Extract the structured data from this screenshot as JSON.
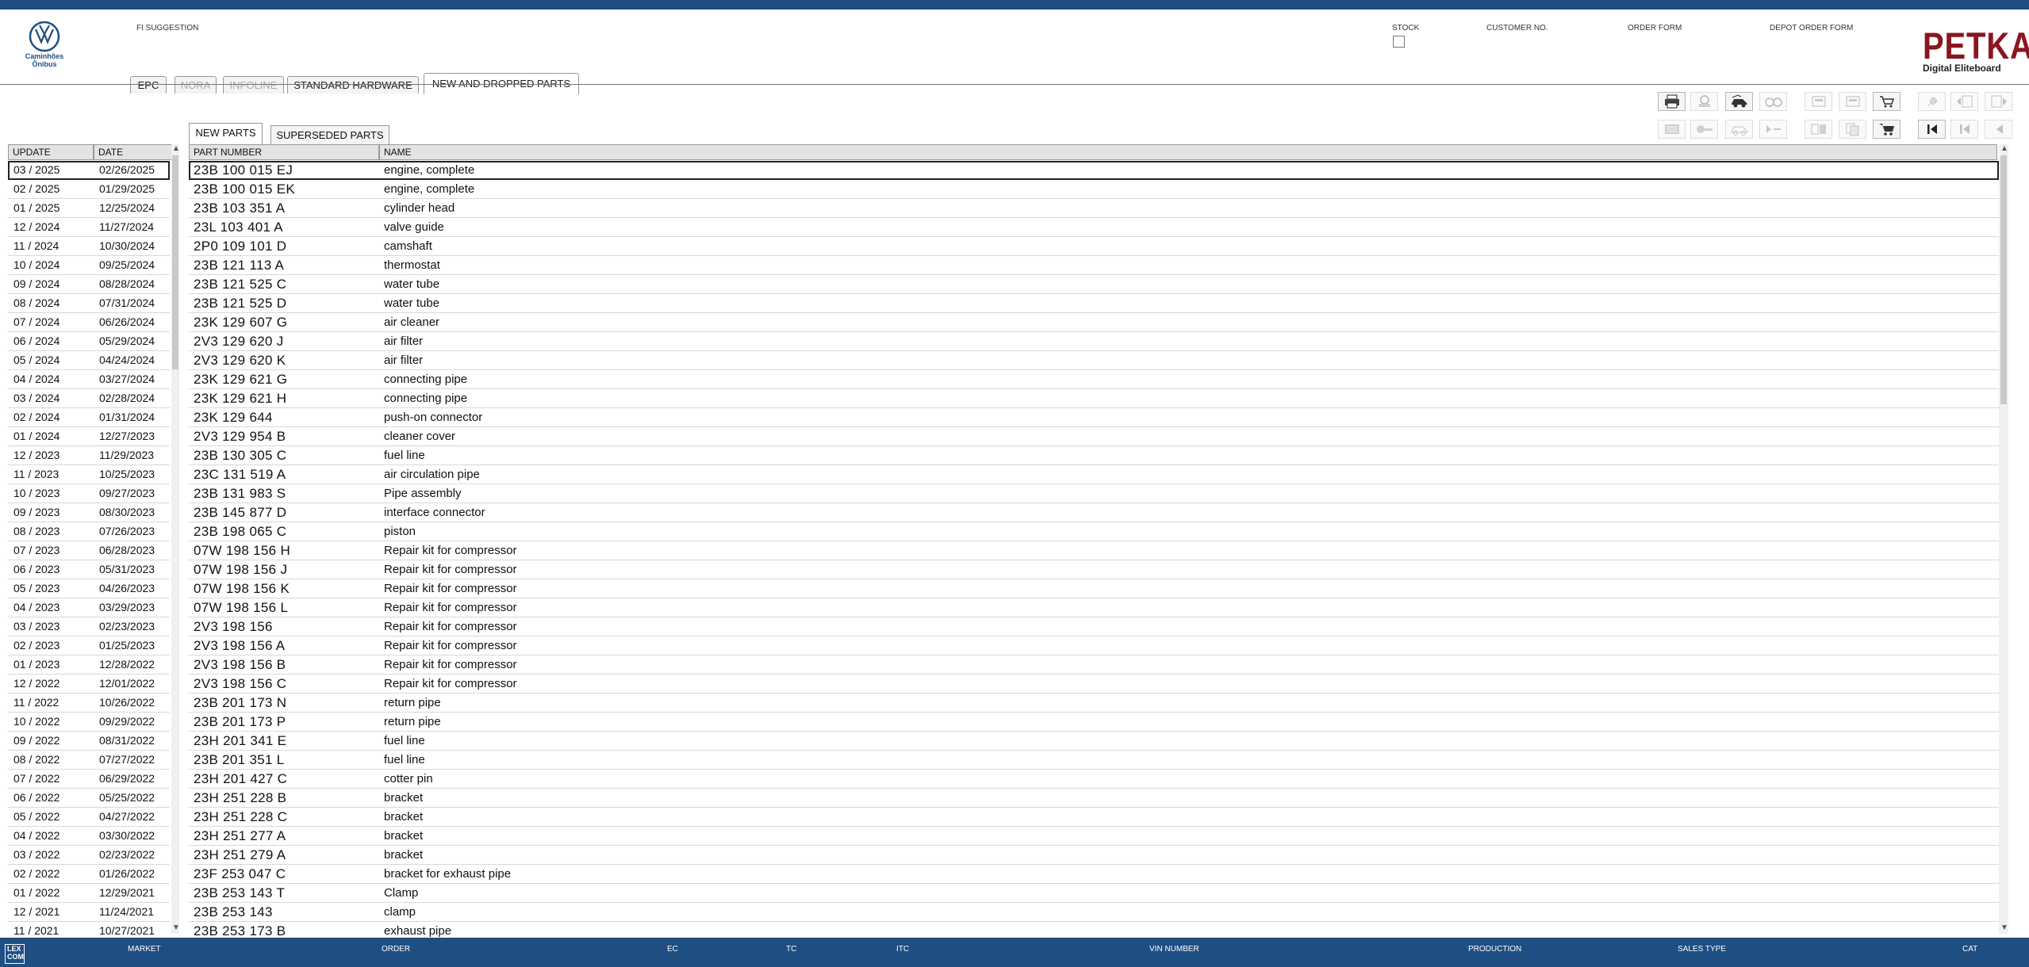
{
  "header": {
    "logo_text_line1": "Caminhões",
    "logo_text_line2": "Ônibus",
    "fi_suggestion": "FI SUGGESTION",
    "stock": "STOCK",
    "customer_no": "CUSTOMER NO.",
    "order_form": "ORDER FORM",
    "depot_order_form": "DEPOT ORDER FORM",
    "brand_big": "PETKA",
    "brand_small": "Digital Eliteboard"
  },
  "main_tabs": [
    {
      "label": "EPC",
      "state": "normal"
    },
    {
      "label": "NORA",
      "state": "disabled"
    },
    {
      "label": "INFOLINE",
      "state": "disabled"
    },
    {
      "label": "STANDARD HARDWARE",
      "state": "normal"
    },
    {
      "label": "NEW AND DROPPED PARTS",
      "state": "active"
    }
  ],
  "sub_tabs": [
    {
      "label": "NEW PARTS",
      "state": "active"
    },
    {
      "label": "SUPERSEDED PARTS",
      "state": "normal"
    }
  ],
  "toolbar": {
    "row1": [
      "print-icon",
      "user-icon",
      "car-icon",
      "glasses-icon",
      "device-icon",
      "device-icon-2",
      "cart-select-icon",
      "pin-icon",
      "page-back-icon",
      "page-forward-icon"
    ],
    "row2": [
      "list-icon",
      "key-icon",
      "car-outline-icon",
      "arrow-dash-icon",
      "layout-icon",
      "copy-icon",
      "cart-icon",
      "first-page-icon",
      "prev-page-icon",
      "prev-icon"
    ]
  },
  "left_table": {
    "headers": [
      "UPDATE",
      "DATE"
    ],
    "selected_index": 0,
    "rows": [
      [
        "03 / 2025",
        "02/26/2025"
      ],
      [
        "02 / 2025",
        "01/29/2025"
      ],
      [
        "01 / 2025",
        "12/25/2024"
      ],
      [
        "12 / 2024",
        "11/27/2024"
      ],
      [
        "11 / 2024",
        "10/30/2024"
      ],
      [
        "10 / 2024",
        "09/25/2024"
      ],
      [
        "09 / 2024",
        "08/28/2024"
      ],
      [
        "08 / 2024",
        "07/31/2024"
      ],
      [
        "07 / 2024",
        "06/26/2024"
      ],
      [
        "06 / 2024",
        "05/29/2024"
      ],
      [
        "05 / 2024",
        "04/24/2024"
      ],
      [
        "04 / 2024",
        "03/27/2024"
      ],
      [
        "03 / 2024",
        "02/28/2024"
      ],
      [
        "02 / 2024",
        "01/31/2024"
      ],
      [
        "01 / 2024",
        "12/27/2023"
      ],
      [
        "12 / 2023",
        "11/29/2023"
      ],
      [
        "11 / 2023",
        "10/25/2023"
      ],
      [
        "10 / 2023",
        "09/27/2023"
      ],
      [
        "09 / 2023",
        "08/30/2023"
      ],
      [
        "08 / 2023",
        "07/26/2023"
      ],
      [
        "07 / 2023",
        "06/28/2023"
      ],
      [
        "06 / 2023",
        "05/31/2023"
      ],
      [
        "05 / 2023",
        "04/26/2023"
      ],
      [
        "04 / 2023",
        "03/29/2023"
      ],
      [
        "03 / 2023",
        "02/23/2023"
      ],
      [
        "02 / 2023",
        "01/25/2023"
      ],
      [
        "01 / 2023",
        "12/28/2022"
      ],
      [
        "12 / 2022",
        "12/01/2022"
      ],
      [
        "11 / 2022",
        "10/26/2022"
      ],
      [
        "10 / 2022",
        "09/29/2022"
      ],
      [
        "09 / 2022",
        "08/31/2022"
      ],
      [
        "08 / 2022",
        "07/27/2022"
      ],
      [
        "07 / 2022",
        "06/29/2022"
      ],
      [
        "06 / 2022",
        "05/25/2022"
      ],
      [
        "05 / 2022",
        "04/27/2022"
      ],
      [
        "04 / 2022",
        "03/30/2022"
      ],
      [
        "03 / 2022",
        "02/23/2022"
      ],
      [
        "02 / 2022",
        "01/26/2022"
      ],
      [
        "01 / 2022",
        "12/29/2021"
      ],
      [
        "12 / 2021",
        "11/24/2021"
      ],
      [
        "11 / 2021",
        "10/27/2021"
      ]
    ]
  },
  "right_table": {
    "headers": [
      "PART NUMBER",
      "NAME"
    ],
    "selected_index": 0,
    "rows": [
      [
        "23B 100 015 EJ",
        "engine, complete"
      ],
      [
        "23B 100 015 EK",
        "engine, complete"
      ],
      [
        "23B 103 351 A",
        "cylinder head"
      ],
      [
        "23L 103 401 A",
        "valve guide"
      ],
      [
        "2P0 109 101 D",
        "camshaft"
      ],
      [
        "23B 121 113 A",
        "thermostat"
      ],
      [
        "23B 121 525 C",
        "water tube"
      ],
      [
        "23B 121 525 D",
        "water tube"
      ],
      [
        "23K 129 607 G",
        "air cleaner"
      ],
      [
        "2V3 129 620 J",
        "air filter"
      ],
      [
        "2V3 129 620 K",
        "air filter"
      ],
      [
        "23K 129 621 G",
        "connecting pipe"
      ],
      [
        "23K 129 621 H",
        "connecting pipe"
      ],
      [
        "23K 129 644",
        "push-on connector"
      ],
      [
        "2V3 129 954 B",
        "cleaner cover"
      ],
      [
        "23B 130 305 C",
        "fuel line"
      ],
      [
        "23C 131 519 A",
        "air circulation pipe"
      ],
      [
        "23B 131 983 S",
        "Pipe assembly"
      ],
      [
        "23B 145 877 D",
        "interface connector"
      ],
      [
        "23B 198 065 C",
        "piston"
      ],
      [
        "07W 198 156 H",
        "Repair kit for compressor"
      ],
      [
        "07W 198 156 J",
        "Repair kit for compressor"
      ],
      [
        "07W 198 156 K",
        "Repair kit for compressor"
      ],
      [
        "07W 198 156 L",
        "Repair kit for compressor"
      ],
      [
        "2V3 198 156",
        "Repair kit for compressor"
      ],
      [
        "2V3 198 156 A",
        "Repair kit for compressor"
      ],
      [
        "2V3 198 156 B",
        "Repair kit for compressor"
      ],
      [
        "2V3 198 156 C",
        "Repair kit for compressor"
      ],
      [
        "23B 201 173 N",
        "return pipe"
      ],
      [
        "23B 201 173 P",
        "return pipe"
      ],
      [
        "23H 201 341 E",
        "fuel line"
      ],
      [
        "23B 201 351 L",
        "fuel line"
      ],
      [
        "23H 201 427 C",
        "cotter pin"
      ],
      [
        "23H 251 228 B",
        "bracket"
      ],
      [
        "23H 251 228 C",
        "bracket"
      ],
      [
        "23H 251 277 A",
        "bracket"
      ],
      [
        "23H 251 279 A",
        "bracket"
      ],
      [
        "23F 253 047 C",
        "bracket for exhaust pipe"
      ],
      [
        "23B 253 143 T",
        "Clamp"
      ],
      [
        "23B 253 143",
        "clamp"
      ],
      [
        "23B 253 173 B",
        "exhaust pipe"
      ]
    ]
  },
  "statusbar": {
    "logo": "LEX COM",
    "market": "MARKET",
    "order": "ORDER",
    "ec": "EC",
    "tc": "TC",
    "itc": "ITC",
    "vin_number": "VIN NUMBER",
    "production": "PRODUCTION",
    "sales_type": "SALES TYPE",
    "cat": "CAT"
  },
  "colors": {
    "header_blue": "#1f4e83",
    "petka_red": "#8a1620"
  }
}
